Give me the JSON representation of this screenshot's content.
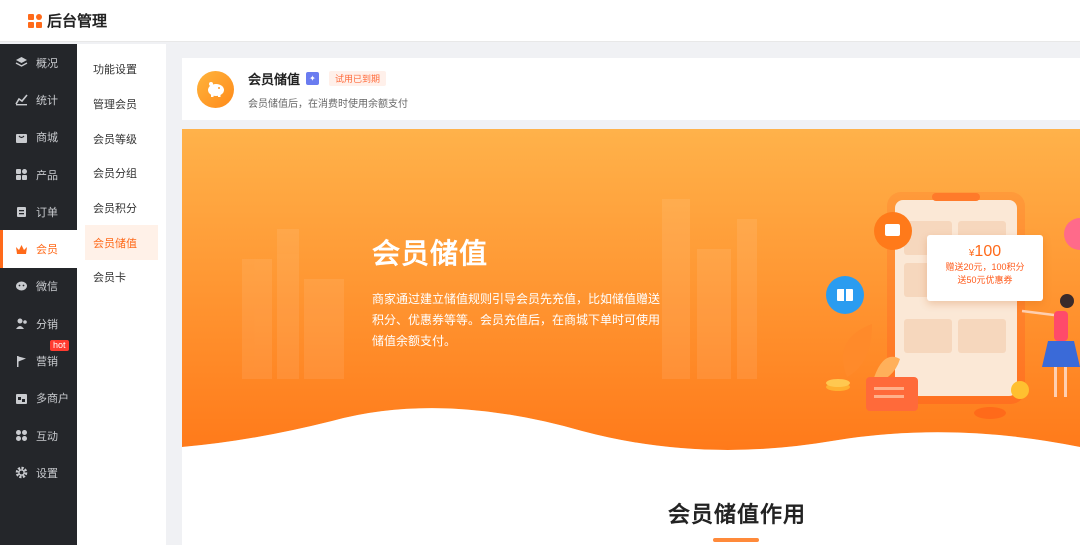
{
  "app": {
    "title": "后台管理"
  },
  "sidebar": {
    "items": [
      {
        "label": "概况",
        "icon": "layers-icon"
      },
      {
        "label": "统计",
        "icon": "chart-icon"
      },
      {
        "label": "商城",
        "icon": "store-icon"
      },
      {
        "label": "产品",
        "icon": "grid-icon"
      },
      {
        "label": "订单",
        "icon": "clipboard-icon"
      },
      {
        "label": "会员",
        "icon": "crown-icon",
        "active": true
      },
      {
        "label": "微信",
        "icon": "wechat-icon"
      },
      {
        "label": "分销",
        "icon": "users-icon"
      },
      {
        "label": "营销",
        "icon": "flag-icon",
        "badge": "hot"
      },
      {
        "label": "多商户",
        "icon": "shop-icon"
      },
      {
        "label": "互动",
        "icon": "apps-icon"
      },
      {
        "label": "设置",
        "icon": "gear-icon"
      }
    ]
  },
  "subnav": {
    "items": [
      {
        "label": "功能设置"
      },
      {
        "label": "管理会员"
      },
      {
        "label": "会员等级"
      },
      {
        "label": "会员分组"
      },
      {
        "label": "会员积分"
      },
      {
        "label": "会员储值",
        "active": true
      },
      {
        "label": "会员卡"
      }
    ]
  },
  "header": {
    "title": "会员储值",
    "trial_badge": "试用已到期",
    "subtitle": "会员储值后，在消费时使用余额支付"
  },
  "banner": {
    "title": "会员储值",
    "description": "商家通过建立储值规则引导会员先充值，比如储值赠送积分、优惠券等等。会员充值后，在商城下单时可使用储值余额支付。",
    "coupon": {
      "currency": "¥",
      "amount": "100",
      "line1": "赠送20元，100积分",
      "line2": "送50元优惠券"
    }
  },
  "section": {
    "title": "会员储值作用"
  },
  "colors": {
    "accent": "#ff6a1a",
    "sidebar_bg": "#24262a",
    "banner_orange": "#ff8a2a"
  }
}
